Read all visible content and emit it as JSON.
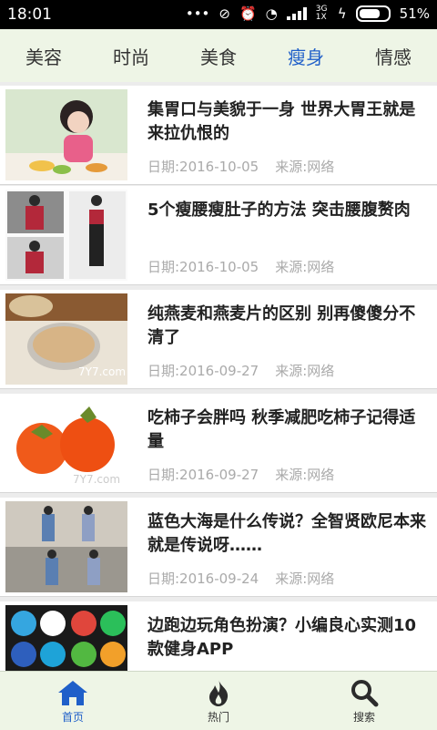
{
  "status_bar": {
    "time": "18:01",
    "network": "3G 1X",
    "battery": "51%"
  },
  "tabs": [
    {
      "label": "美容"
    },
    {
      "label": "时尚"
    },
    {
      "label": "美食"
    },
    {
      "label": "瘦身",
      "active": true
    },
    {
      "label": "情感"
    }
  ],
  "articles": [
    {
      "title": "集胃口与美貌于一身 世界大胃王就是来拉仇恨的",
      "date": "日期:2016-10-05",
      "source": "来源:网络"
    },
    {
      "title": "5个瘦腰瘦肚子的方法 突击腰腹赘肉",
      "date": "日期:2016-10-05",
      "source": "来源:网络"
    },
    {
      "title": "纯燕麦和燕麦片的区别 别再傻傻分不清了",
      "date": "日期:2016-09-27",
      "source": "来源:网络",
      "watermark": "7Y7.com"
    },
    {
      "title": "吃柿子会胖吗 秋季减肥吃柿子记得适量",
      "date": "日期:2016-09-27",
      "source": "来源:网络",
      "watermark": "7Y7.com"
    },
    {
      "title": "蓝色大海是什么传说？全智贤欧尼本来就是传说呀……",
      "date": "日期:2016-09-24",
      "source": "来源:网络"
    },
    {
      "title": "边跑边玩角色扮演？小编良心实测10款健身APP",
      "date": "",
      "source": ""
    }
  ],
  "bottom_nav": [
    {
      "label": "首页",
      "icon": "home-icon",
      "active": true
    },
    {
      "label": "热门",
      "icon": "flame-icon"
    },
    {
      "label": "搜索",
      "icon": "search-icon"
    }
  ],
  "colors": {
    "accent": "#1f5fc9",
    "bar_bg": "#eef5e6"
  }
}
